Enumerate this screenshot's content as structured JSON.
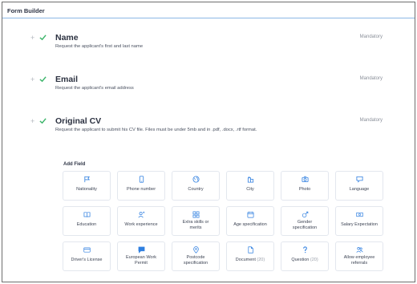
{
  "header": {
    "title": "Form Builder"
  },
  "fields": [
    {
      "title": "Name",
      "description": "Request the applicant's first and last name",
      "status": "Mandatory"
    },
    {
      "title": "Email",
      "description": "Request the applicant's email address",
      "status": "Mandatory"
    },
    {
      "title": "Original CV",
      "description": "Request the applicant to submit his CV file. Files must be under 5mb and in .pdf, .docx, .rtf format.",
      "status": "Mandatory"
    }
  ],
  "add_field": {
    "label": "Add Field",
    "tiles": [
      {
        "label": "Nationality",
        "icon": "flag-icon"
      },
      {
        "label": "Phone number",
        "icon": "phone-icon"
      },
      {
        "label": "Country",
        "icon": "globe-icon"
      },
      {
        "label": "City",
        "icon": "city-icon"
      },
      {
        "label": "Photo",
        "icon": "camera-icon"
      },
      {
        "label": "Language",
        "icon": "chat-icon"
      },
      {
        "label": "Education",
        "icon": "book-icon"
      },
      {
        "label": "Work experience",
        "icon": "user-plus-icon"
      },
      {
        "label": "Extra skills or merits",
        "icon": "grid-icon"
      },
      {
        "label": "Age specification",
        "icon": "calendar-icon"
      },
      {
        "label": "Gender specification",
        "icon": "gender-icon"
      },
      {
        "label": "Salary Expectation",
        "icon": "money-icon"
      },
      {
        "label": "Driver's License",
        "icon": "card-icon"
      },
      {
        "label": "European Work Permit",
        "icon": "message-flag-icon"
      },
      {
        "label": "Postcode specification",
        "icon": "pin-icon"
      },
      {
        "label": "Document",
        "count": "(20)",
        "icon": "document-icon"
      },
      {
        "label": "Question",
        "count": "(20)",
        "icon": "question-icon"
      },
      {
        "label": "Allow employee referrals",
        "icon": "people-icon"
      }
    ]
  },
  "colors": {
    "accent": "#2f7fe0",
    "check": "#3db56b",
    "border": "#e3e7ee",
    "header_rule": "#8cb8e6"
  }
}
